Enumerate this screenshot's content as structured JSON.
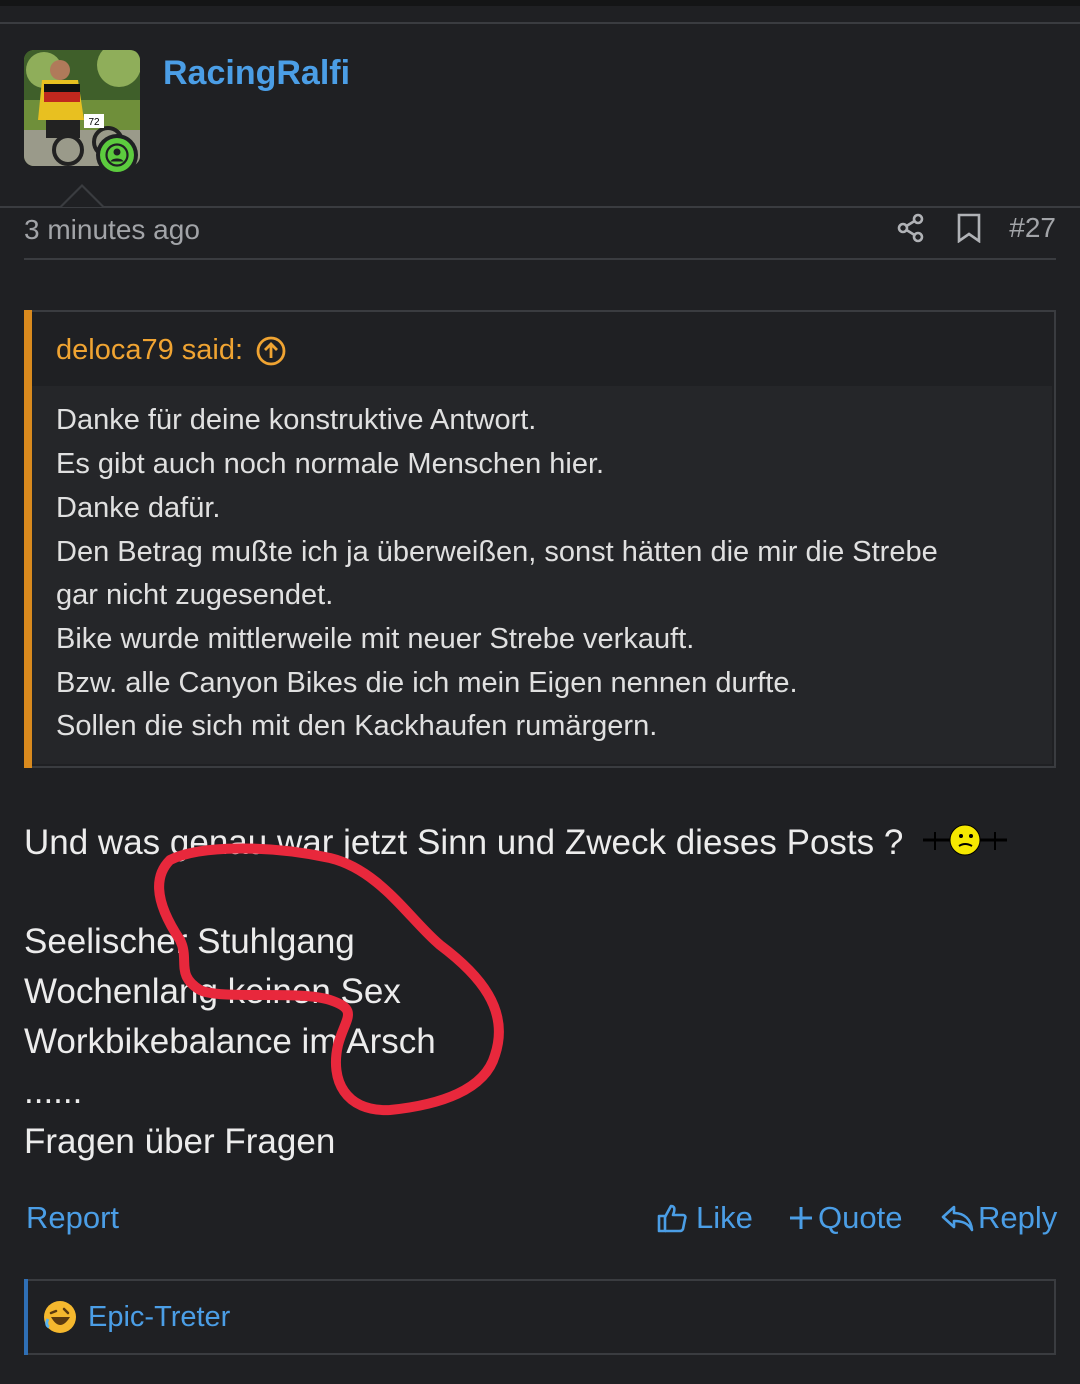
{
  "user": {
    "name": "RacingRalfi",
    "avatar_number": "72"
  },
  "post_meta": {
    "time": "3 minutes ago",
    "number": "#27"
  },
  "quote": {
    "author": "deloca79 said:",
    "lines": [
      "Danke für deine konstruktive Antwort.",
      "Es gibt auch noch normale Menschen hier.",
      "Danke dafür.",
      "Den Betrag mußte ich ja überweißen, sonst hätten die mir die Strebe",
      "gar nicht zugesendet.",
      "Bike wurde mittlerweile mit neuer Strebe verkauft.",
      "Bzw. alle Canyon Bikes die ich mein Eigen nennen durfte.",
      "Sollen die sich mit den Kackhaufen rumärgern."
    ]
  },
  "message": {
    "lines": [
      "Und was genau war jetzt Sinn und Zweck dieses Posts ?",
      "Seelischer Stuhlgang",
      "Wochenlang keinen Sex",
      "Workbikebalance im Arsch",
      "......",
      "Fragen über Fragen"
    ]
  },
  "actions": {
    "report": "Report",
    "like": "Like",
    "quote": "Quote",
    "reply": "Reply"
  },
  "reactions": {
    "user": "Epic-Treter"
  },
  "colors": {
    "background": "#1f2023",
    "link": "#4b9ee6",
    "quote_accent": "#d98a1e",
    "annotation": "#e8283c"
  }
}
